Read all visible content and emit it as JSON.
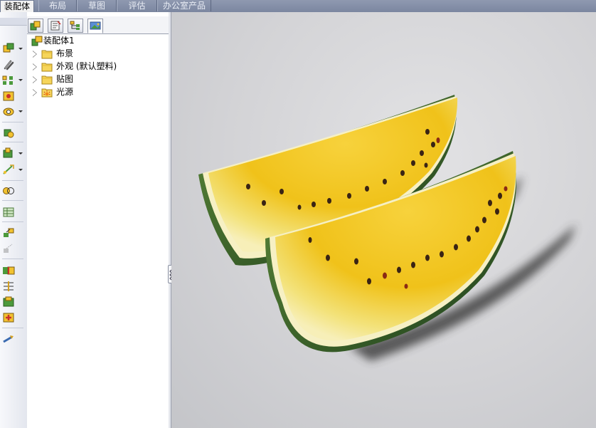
{
  "tabs": [
    {
      "label": "装配体",
      "active": true
    },
    {
      "label": "布局",
      "active": false
    },
    {
      "label": "草图",
      "active": false
    },
    {
      "label": "评估",
      "active": false
    },
    {
      "label": "办公室产品",
      "active": false
    }
  ],
  "feature_manager": {
    "root": "装配体1",
    "items": [
      {
        "label": "布景",
        "icon": "folder-icon"
      },
      {
        "label": "外观 (默认塑料)",
        "icon": "folder-icon"
      },
      {
        "label": "贴图",
        "icon": "folder-icon"
      },
      {
        "label": "光源",
        "icon": "lights-folder-icon"
      }
    ],
    "panel_tabs": [
      "feature-manager-tab-icon",
      "property-manager-tab-icon",
      "configuration-manager-tab-icon",
      "display-manager-tab-icon"
    ]
  },
  "toolbar": {
    "tools": [
      "insert-components-icon",
      "mate-icon",
      "component-pattern-icon",
      "smart-fasteners-icon",
      "move-component-icon",
      "show-hidden-components-icon",
      "assembly-features-icon",
      "reference-geometry-icon",
      "new-motion-study-icon",
      "bill-of-materials-icon",
      "exploded-view-icon",
      "explode-line-sketch-icon",
      "interference-detection-icon",
      "clearance-verification-icon",
      "hole-alignment-icon",
      "instant3d-icon",
      "large-assembly-mode-icon"
    ]
  },
  "colors": {
    "tab_bar": "#7b86a0",
    "viewport_bg": "#d3d3d6",
    "watermelon_flesh": "#f0c21a",
    "watermelon_rind": "#2f5a2a"
  }
}
